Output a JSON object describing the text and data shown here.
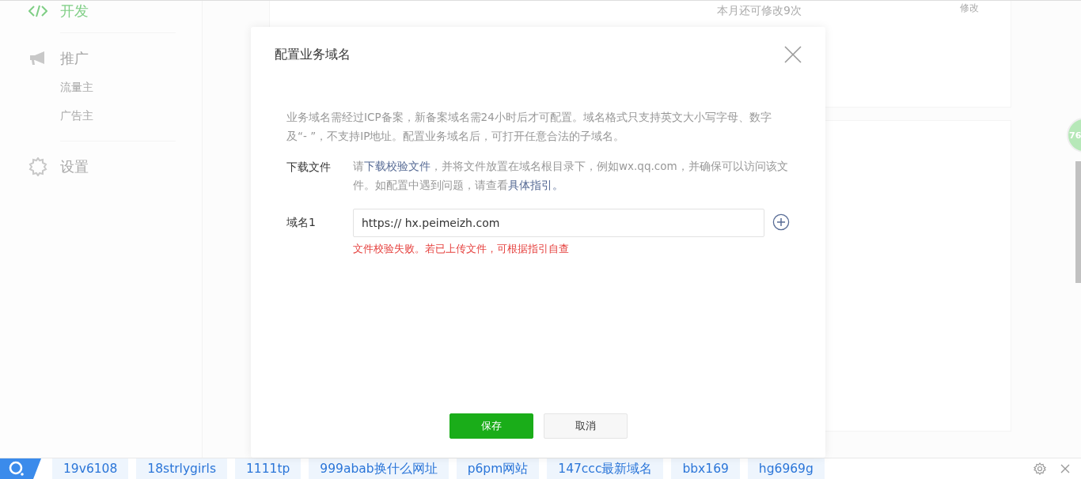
{
  "sidebar": {
    "items": [
      {
        "label": "开发",
        "kind": "code",
        "selected": true
      },
      {
        "label": "推广",
        "kind": "megaphone",
        "selected": false,
        "children": [
          {
            "label": "流量主"
          },
          {
            "label": "广告主"
          }
        ]
      },
      {
        "label": "设置",
        "kind": "gear",
        "selected": false
      }
    ]
  },
  "background_card": {
    "note": "本月还可修改9次",
    "action": "修改"
  },
  "dialog": {
    "title": "配置业务域名",
    "intro": "业务域名需经过ICP备案，新备案域名需24小时后才可配置。域名格式只支持英文大小写字母、数字及“- ”，不支持IP地址。配置业务域名后，可打开任意合法的子域名。",
    "download": {
      "label": "下载文件",
      "parts": [
        {
          "kind": "text",
          "text": "请"
        },
        {
          "kind": "link",
          "text": "下载校验文件"
        },
        {
          "kind": "text",
          "text": "，并将文件放置在域名根目录下，例如wx.qq.com，并确保可以访问该文件。如配置中遇到问题，请查看"
        },
        {
          "kind": "link",
          "text": "具体指引。"
        }
      ]
    },
    "domains": [
      {
        "label": "域名1",
        "value": "https:// hx.peimeizh.com",
        "error": "文件校验失败。若已上传文件，可根据指引自查"
      }
    ],
    "buttons": [
      {
        "label": "保存",
        "kind": "primary"
      },
      {
        "label": "取消",
        "kind": "secondary"
      }
    ]
  },
  "float_badge": "76",
  "search_bar": {
    "tags": [
      "19v6108",
      "18strlygirls",
      "1111tp",
      "999abab换什么网址",
      "p6pm网站",
      "147ccc最新域名",
      "bbx169",
      "hg6969g"
    ]
  }
}
